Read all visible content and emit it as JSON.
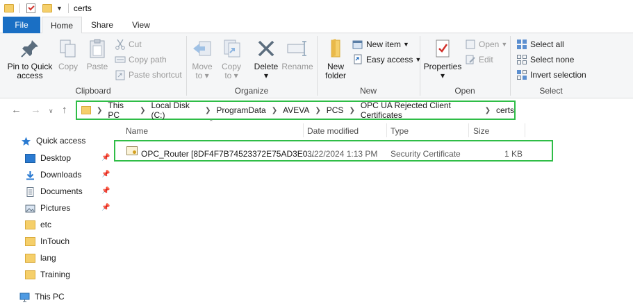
{
  "window": {
    "title": "certs"
  },
  "tabs": {
    "file": "File",
    "home": "Home",
    "share": "Share",
    "view": "View"
  },
  "ribbon": {
    "clipboard": {
      "label": "Clipboard",
      "pin_line1": "Pin to Quick",
      "pin_line2": "access",
      "copy": "Copy",
      "paste": "Paste",
      "cut": "Cut",
      "copy_path": "Copy path",
      "paste_shortcut": "Paste shortcut"
    },
    "organize": {
      "label": "Organize",
      "move_to": "Move",
      "move_to2": "to",
      "copy_to": "Copy",
      "copy_to2": "to",
      "delete": "Delete",
      "rename": "Rename"
    },
    "new": {
      "label": "New",
      "new_folder1": "New",
      "new_folder2": "folder",
      "new_item": "New item",
      "easy_access": "Easy access"
    },
    "open": {
      "label": "Open",
      "properties": "Properties",
      "open": "Open",
      "edit": "Edit"
    },
    "select": {
      "label": "Select",
      "select_all": "Select all",
      "select_none": "Select none",
      "invert": "Invert selection"
    }
  },
  "address": {
    "crumbs": [
      "This PC",
      "Local Disk (C:)",
      "ProgramData",
      "AVEVA",
      "PCS",
      "OPC UA Rejected Client Certificates",
      "certs"
    ]
  },
  "nav": {
    "quick_access": "Quick access",
    "items": [
      "Desktop",
      "Downloads",
      "Documents",
      "Pictures",
      "etc",
      "InTouch",
      "lang",
      "Training"
    ],
    "this_pc": "This PC"
  },
  "columns": {
    "name": "Name",
    "date": "Date modified",
    "type": "Type",
    "size": "Size"
  },
  "files": [
    {
      "name": "OPC_Router [8DF4F7B74523372E75AD3E0...",
      "date": "3/22/2024 1:13 PM",
      "type": "Security Certificate",
      "size": "1 KB"
    }
  ],
  "colors": {
    "accent": "#1a6fc4",
    "highlight": "#2fbd47",
    "folder": "#f5cf6a"
  }
}
